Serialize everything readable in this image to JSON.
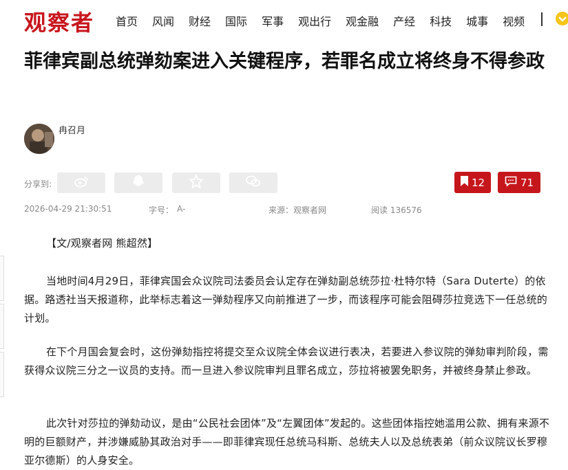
{
  "site": {
    "logo": "观察者"
  },
  "nav": {
    "items": [
      "首页",
      "风闻",
      "财经",
      "国际",
      "军事",
      "观出行",
      "观金融",
      "产经",
      "科技",
      "城事",
      "视频"
    ]
  },
  "article": {
    "title": "菲律宾副总统弹劾案进入关键程序，若罪名成立将终身不得参政",
    "author": "冉召月",
    "share_label": "分享到:",
    "bookmarks": "12",
    "comments": "71",
    "meta": {
      "datetime": "2026-04-29 21:30:51",
      "font_size_label": "字号：",
      "font_size_value": "A-",
      "source_label": "来源：观察者网",
      "views_label": "阅读 136576"
    },
    "byline": "【文/观察者网 熊超然】",
    "paragraphs": [
      "当地时间4月29日，菲律宾国会众议院司法委员会认定存在弹劾副总统莎拉·杜特尔特（Sara Duterte）的依据。路透社当天报道称，此举标志着这一弹劾程序又向前推进了一步，而该程序可能会阻碍莎拉竞选下一任总统的计划。",
      "在下个月国会复会时，这份弹劾指控将提交至众议院全体会议进行表决，若要进入参议院的弹劾审判阶段，需获得众议院三分之一议员的支持。而一旦进入参议院审判且罪名成立，莎拉将被罢免职务，并被终身禁止参政。",
      "此次针对莎拉的弹劾动议，是由“公民社会团体”及“左翼团体”发起的。这些团体指控她滥用公款、拥有来源不明的巨额财产，并涉嫌威胁其政治对手——即菲律宾现任总统马科斯、总统夫人以及总统表弟（前众议院议长罗穆亚尔德斯）的人身安全。"
    ]
  },
  "colors": {
    "brand": "#c8161d",
    "stat_button": "#c5161c",
    "share_button": "#ececec"
  },
  "icons": {
    "share": [
      "weibo-icon",
      "qq-icon",
      "qzone-star-icon",
      "wechat-icon"
    ],
    "bookmark": "bookmark-icon",
    "comment": "comment-icon"
  }
}
